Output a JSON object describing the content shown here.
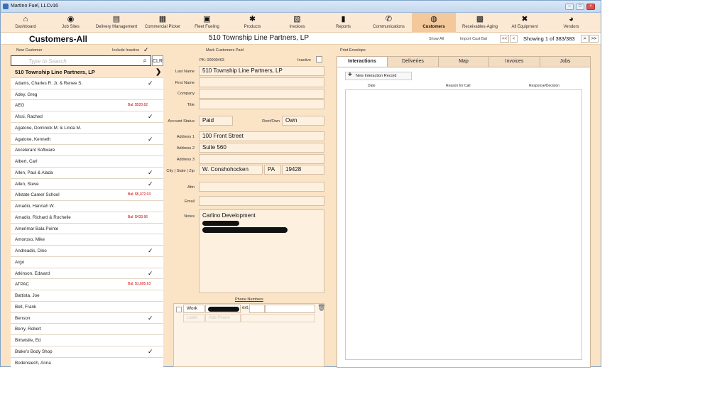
{
  "window": {
    "title": "Martino Fuel, LLCv16"
  },
  "nav": [
    {
      "label": "Dashboard",
      "icon": "home-icon",
      "glyph": "⌂"
    },
    {
      "label": "Job Sites",
      "icon": "globe-icon",
      "glyph": "◉"
    },
    {
      "label": "Delivery Management",
      "icon": "delivery-icon",
      "glyph": "▤"
    },
    {
      "label": "Commercial Picker",
      "icon": "clipboard-icon",
      "glyph": "▦"
    },
    {
      "label": "Fleet Fueling",
      "icon": "truck-icon",
      "glyph": "▣"
    },
    {
      "label": "Products",
      "icon": "gear-icon",
      "glyph": "✱"
    },
    {
      "label": "Invoices",
      "icon": "invoice-icon",
      "glyph": "▧"
    },
    {
      "label": "Reports",
      "icon": "report-icon",
      "glyph": "▮"
    },
    {
      "label": "Communications",
      "icon": "phone-icon",
      "glyph": "✆"
    },
    {
      "label": "Customers",
      "icon": "customers-icon",
      "glyph": "◍"
    },
    {
      "label": "Receivables-Aging",
      "icon": "receivables-icon",
      "glyph": "▩"
    },
    {
      "label": "All Equipment",
      "icon": "equipment-icon",
      "glyph": "✖"
    },
    {
      "label": "Vendors",
      "icon": "vendors-icon",
      "glyph": "◕"
    }
  ],
  "header": {
    "title": "Customers-All",
    "record_name": "510 Township Line Partners, LP",
    "show_all": "Show All",
    "import_cust_bal": "Import Cust Bal",
    "first": "<<",
    "prev": "<",
    "next": ">",
    "last": ">>",
    "showing": "Showing 1 of 383/383"
  },
  "left": {
    "new_customer": "New Customer",
    "include_inactive": "Include Inactive",
    "include_inactive_check": "✓",
    "search_placeholder": "Type to Search",
    "clr": "CLR",
    "customers": [
      {
        "name": "510 Township Line Partners, LP",
        "check": "",
        "bal": "",
        "arrow": "❯"
      },
      {
        "name": "Adams, Charles R. Jr. & Renee S.",
        "check": "✓",
        "bal": ""
      },
      {
        "name": "Adey, Greg",
        "check": "",
        "bal": ""
      },
      {
        "name": "AEG",
        "check": "",
        "bal": "Bal: $520.62"
      },
      {
        "name": "Afssi, Rached",
        "check": "✓",
        "bal": ""
      },
      {
        "name": "Agatone, Dominick M. & Linda M.",
        "check": "",
        "bal": ""
      },
      {
        "name": "Agatone, Kenneth",
        "check": "✓",
        "bal": ""
      },
      {
        "name": "Akcelerant Software",
        "check": "",
        "bal": ""
      },
      {
        "name": "Albert, Carl",
        "check": "",
        "bal": ""
      },
      {
        "name": "Allen, Paul & Alada",
        "check": "✓",
        "bal": ""
      },
      {
        "name": "Allen, Steve",
        "check": "✓",
        "bal": ""
      },
      {
        "name": "Allstate Career School",
        "check": "",
        "bal": "Bal: $5,072.03"
      },
      {
        "name": "Amadio, Hannah W.",
        "check": "",
        "bal": ""
      },
      {
        "name": "Amadio, Richard & Rochelle",
        "check": "",
        "bal": "Bal: $433.96"
      },
      {
        "name": "Amerimar Bala Pointe",
        "check": "",
        "bal": ""
      },
      {
        "name": "Amoroso, Mike",
        "check": "",
        "bal": ""
      },
      {
        "name": "Andreadis, Dino",
        "check": "✓",
        "bal": ""
      },
      {
        "name": "Argo",
        "check": "",
        "bal": ""
      },
      {
        "name": "Atkinson, Edward",
        "check": "✓",
        "bal": ""
      },
      {
        "name": "ATPAC",
        "check": "",
        "bal": "Bal: $1,695.63"
      },
      {
        "name": "Battista, Joe",
        "check": "",
        "bal": ""
      },
      {
        "name": "Bell, Frank",
        "check": "",
        "bal": ""
      },
      {
        "name": "Benson",
        "check": "✓",
        "bal": ""
      },
      {
        "name": "Berry, Robert",
        "check": "",
        "bal": ""
      },
      {
        "name": "Birtwistle, Ed",
        "check": "",
        "bal": ""
      },
      {
        "name": "Blake's Body Shop",
        "check": "✓",
        "bal": ""
      },
      {
        "name": "Bodensiech, Anna",
        "check": "",
        "bal": ""
      }
    ]
  },
  "form": {
    "mark_paid": "Mark Customers Paid",
    "pk": "PK: 00000463",
    "inactive": "Inactive",
    "labels": {
      "last_name": "Last Name",
      "first_name": "First Name",
      "company": "Company",
      "title": "Title",
      "account_status": "Account Status",
      "rent_own": "Rent/Own",
      "address1": "Address 1",
      "address2": "Address 2",
      "address3": "Address 3",
      "city_state_zip": "City | State | Zip",
      "attn": "Attn",
      "email": "Email",
      "notes": "Notes"
    },
    "values": {
      "last_name": "510 Township Line Partners, LP",
      "first_name": "",
      "company": "",
      "title": "",
      "account_status": "Paid",
      "rent_own": "Own",
      "address1": "100 Front Street",
      "address2": "Suite 560",
      "address3": "",
      "city": "W. Conshohocken",
      "state": "PA",
      "zip": "19428",
      "attn": "",
      "email": "",
      "notes": "Carlino Development"
    },
    "phone_numbers": "Phone Numbers",
    "phone": {
      "type": "Work",
      "ext": "ext.",
      "label_ph": "Label",
      "add_phone": "Add Phone"
    }
  },
  "right": {
    "print_envelope": "Print Envelope",
    "tabs": [
      "Interactions",
      "Deliveries",
      "Map",
      "Invoices",
      "Jobs"
    ],
    "new_interaction": "New Interaction Record",
    "columns": [
      "Date",
      "Reason for Call",
      "Response/Decision"
    ]
  }
}
